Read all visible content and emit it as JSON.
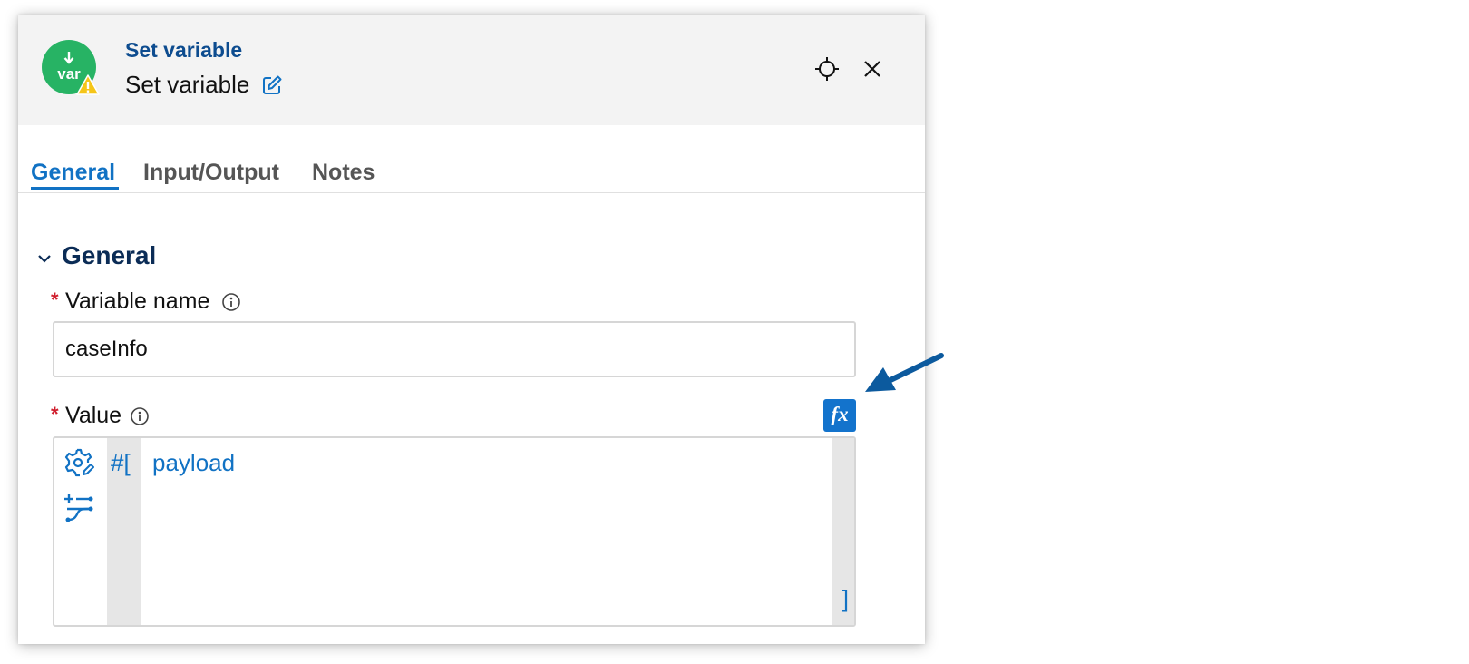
{
  "header": {
    "node_icon_text": "var",
    "title": "Set variable",
    "subtitle": "Set variable"
  },
  "tabs": [
    {
      "label": "General",
      "active": true
    },
    {
      "label": "Input/Output",
      "active": false
    },
    {
      "label": "Notes",
      "active": false
    }
  ],
  "section": {
    "title": "General",
    "expanded": true
  },
  "fields": {
    "variable_name": {
      "label": "Variable name",
      "required_marker": "*",
      "value": "caseInfo"
    },
    "value": {
      "label": "Value",
      "required_marker": "*",
      "fx_label": "fx",
      "expr_open": "#[",
      "expr_code": "payload",
      "expr_close": "]"
    }
  },
  "colors": {
    "accent": "#1172c4",
    "title_blue": "#0d4c8f",
    "node_green": "#27b364",
    "warning_yellow": "#f5c518",
    "required_red": "#d01f2e",
    "callout_arrow": "#0c5a9e"
  },
  "icons": [
    "var-node-icon",
    "warning-icon",
    "edit-icon",
    "locate-icon",
    "close-icon",
    "chevron-down-icon",
    "info-icon",
    "fx-icon",
    "gear-pencil-icon",
    "data-mapping-icon",
    "callout-arrow"
  ]
}
